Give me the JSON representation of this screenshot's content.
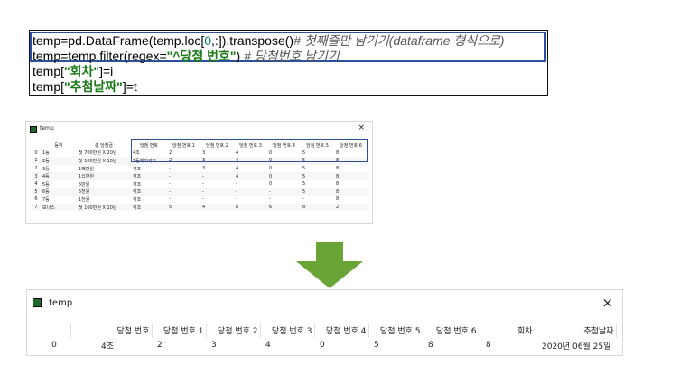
{
  "code": {
    "line1": {
      "a": "temp=pd.DataFrame(temp.loc[",
      "n0": "0",
      "b": ",:]).transpose()",
      "comment": "# 첫째줄만 남기기(dataframe 형식으로)"
    },
    "line2": {
      "a": "temp=temp.filter(regex=",
      "str": "\"^당첨 번호\"",
      "b": ") ",
      "comment": "# 당첨번호 남기기"
    },
    "line3": {
      "a": "temp[",
      "str": "\"회차\"",
      "b": "]=i"
    },
    "line4": {
      "a": "temp[",
      "str": "\"추첨날짜\"",
      "b": "]=t"
    }
  },
  "small_window": {
    "title": "temp",
    "close": "×",
    "headers": [
      "",
      "등위",
      "총 당첨금",
      "당첨 번호",
      "당첨 번호.1",
      "당첨 번호.2",
      "당첨 번호.3",
      "당첨 번호.4",
      "당첨 번호.5",
      "당첨 번호.6"
    ],
    "rows": [
      [
        "0",
        "1등",
        "첫 700만원 X 20년",
        "4조",
        "2",
        "3",
        "4",
        "0",
        "5",
        "8"
      ],
      [
        "1",
        "2등",
        "첫 100만원 X 10년",
        "1등제외각조",
        "2",
        "3",
        "4",
        "0",
        "5",
        "8"
      ],
      [
        "2",
        "3등",
        "1백만원",
        "각조",
        "-",
        "3",
        "4",
        "0",
        "5",
        "8"
      ],
      [
        "3",
        "4등",
        "1십만원",
        "각조",
        "-",
        "-",
        "4",
        "0",
        "5",
        "8"
      ],
      [
        "4",
        "5등",
        "5만원",
        "각조",
        "-",
        "-",
        "-",
        "0",
        "5",
        "8"
      ],
      [
        "5",
        "6등",
        "5천원",
        "각조",
        "-",
        "-",
        "-",
        "-",
        "5",
        "8"
      ],
      [
        "6",
        "7등",
        "1천원",
        "각조",
        "-",
        "-",
        "-",
        "-",
        "-",
        "8"
      ],
      [
        "7",
        "보너스",
        "첫 100만원 X 10년",
        "각조",
        "5",
        "4",
        "8",
        "6",
        "8",
        "2"
      ]
    ]
  },
  "big_window": {
    "title": "temp",
    "close": "×",
    "headers": [
      "",
      "당첨 번호",
      "당첨 번호.1",
      "당첨 번호.2",
      "당첨 번호.3",
      "당첨 번호.4",
      "당첨 번호.5",
      "당첨 번호.6",
      "회차",
      "추첨날짜"
    ],
    "row": [
      "0",
      "4조",
      "2",
      "3",
      "4",
      "0",
      "5",
      "8",
      "8",
      "2020년 06월 25일"
    ]
  },
  "colors": {
    "highlight_box": "#2e4f9e",
    "arrow": "#6aa336",
    "string": "#1a7a1a"
  }
}
